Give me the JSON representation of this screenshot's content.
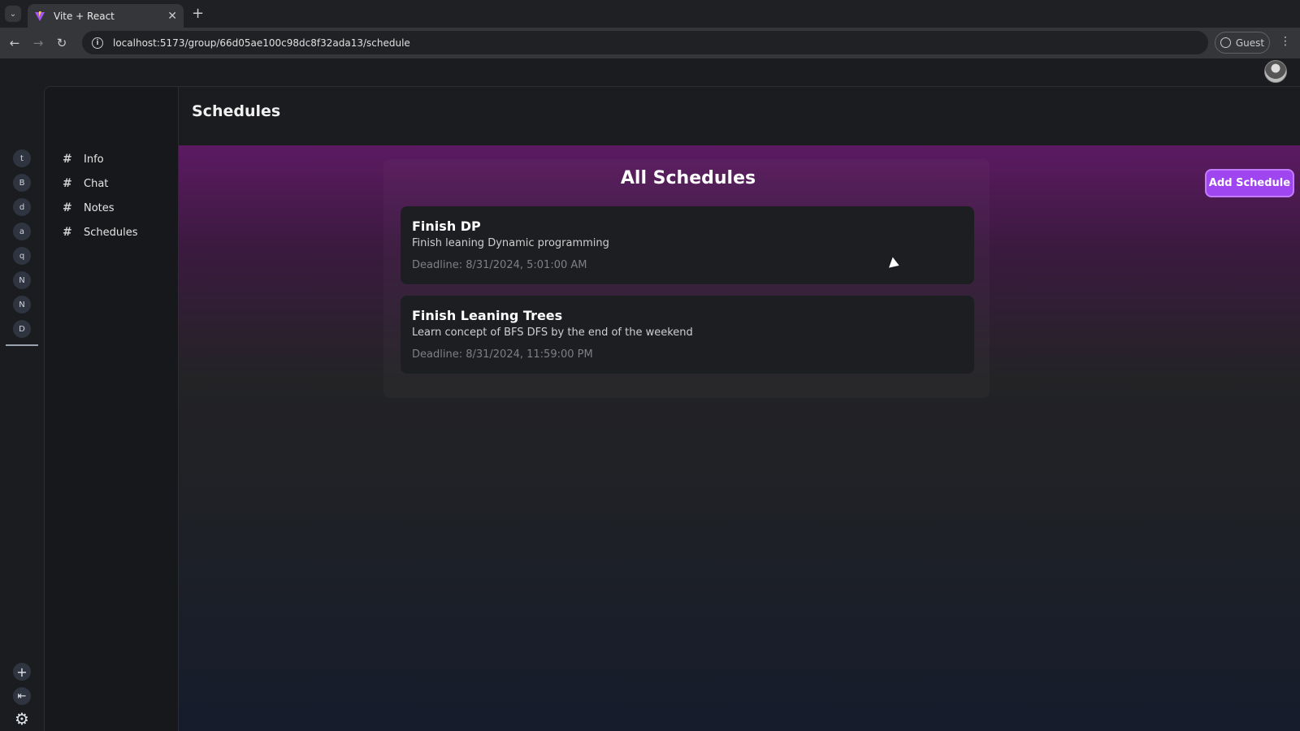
{
  "browser": {
    "tab_title": "Vite + React",
    "url": "localhost:5173/group/66d05ae100c98dc8f32ada13/schedule",
    "profile_label": "Guest"
  },
  "groups": [
    "t",
    "B",
    "d",
    "a",
    "q",
    "N",
    "N",
    "D"
  ],
  "channels": [
    {
      "label": "Info"
    },
    {
      "label": "Chat"
    },
    {
      "label": "Notes"
    },
    {
      "label": "Schedules"
    }
  ],
  "header": {
    "title": "Schedules"
  },
  "schedules": {
    "title": "All Schedules",
    "add_label": "Add Schedule",
    "items": [
      {
        "title": "Finish DP",
        "description": "Finish leaning Dynamic programming",
        "deadline": "Deadline: 8/31/2024, 5:01:00 AM"
      },
      {
        "title": "Finish Leaning Trees",
        "description": "Learn concept of BFS DFS by the end of the weekend",
        "deadline": "Deadline: 8/31/2024, 11:59:00 PM"
      }
    ]
  },
  "colors": {
    "accent": "#a046f0",
    "header_gradient": "#6a1c6e"
  }
}
